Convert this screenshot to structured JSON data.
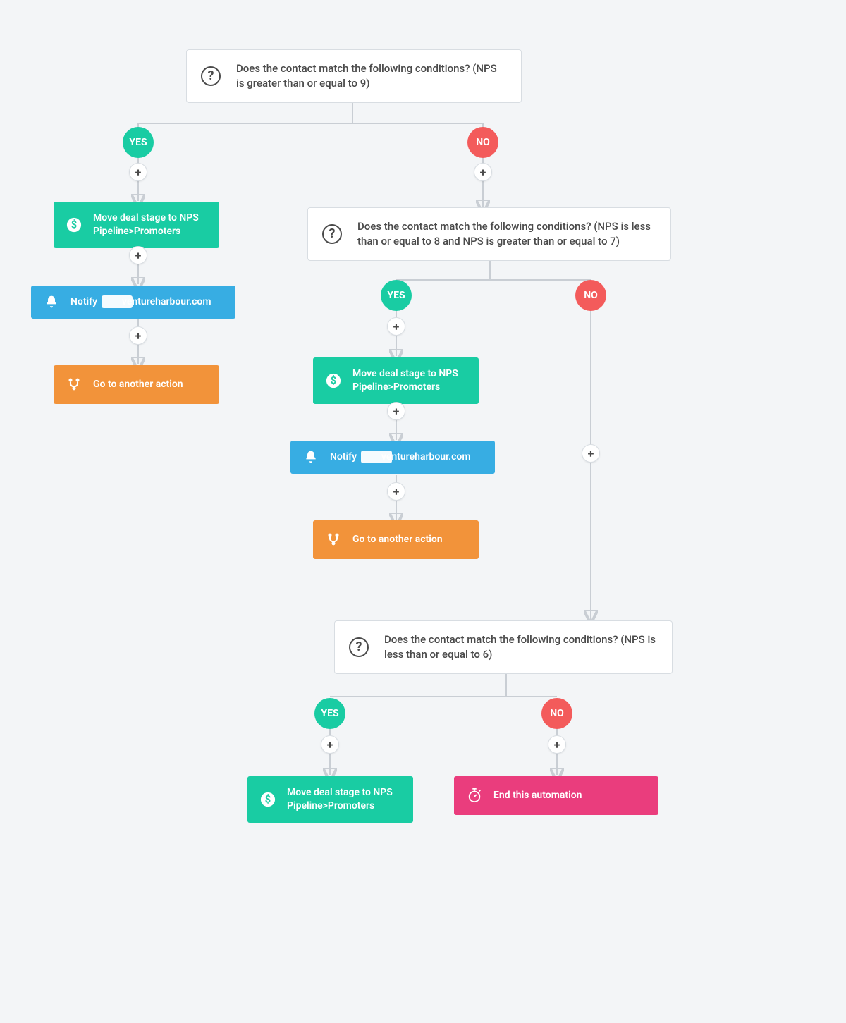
{
  "labels": {
    "yes": "YES",
    "no": "NO",
    "plus": "+"
  },
  "conditions": {
    "c1": "Does the contact match the following conditions? (NPS is greater than or equal to 9)",
    "c2": "Does the contact match the following conditions? (NPS is less than or equal to 8 and NPS is greater than or equal to 7)",
    "c3": "Does the contact match the following conditions? (NPS is less than or equal to 6)"
  },
  "actions": {
    "move_deal": "Move deal stage to NPS Pipeline>Promoters",
    "notify": "Notify          ventureharbour.com",
    "goto": "Go to another action",
    "end": "End this automation"
  }
}
